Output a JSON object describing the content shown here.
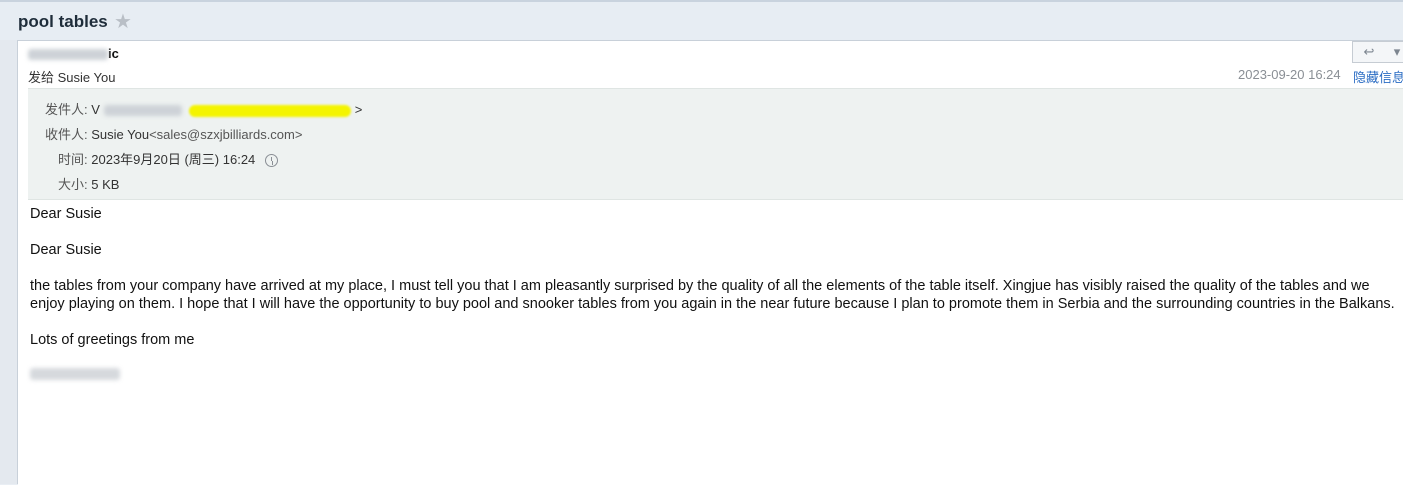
{
  "subject": "pool tables",
  "header": {
    "sender_name_visible": "ic",
    "to_line": "发给 Susie You",
    "date": "2023-09-20 16:24",
    "hide_details": "隐藏信息"
  },
  "icons": {
    "star": "star-icon",
    "reply": "reply-icon",
    "more": "chevron-down-icon",
    "history": "clock-icon"
  },
  "details": {
    "from_label": "发件人:",
    "from_value": "V",
    "from_suffix": ">",
    "to_label": "收件人:",
    "to_name": "Susie You",
    "to_email": "<sales@szxjbilliards.com>",
    "time_label": "时间:",
    "time_value": "2023年9月20日 (周三) 16:24",
    "size_label": "大小:",
    "size_value": "5 KB"
  },
  "body": {
    "greeting1": "Dear Susie",
    "greeting2": "Dear Susie",
    "paragraph": "the tables from your company have arrived at my place, I must tell you that I am pleasantly surprised by the quality of all the elements of the table itself. Xingjue has visibly raised the quality of the tables and we enjoy playing on them. I hope that I will have the opportunity to buy pool and snooker tables from you again in the near future because I plan to promote them in Serbia and the surrounding countries in the Balkans.",
    "closing": "Lots of greetings from me"
  },
  "colors": {
    "link": "#2a6cc3",
    "highlight": "#f4f400",
    "meta_bg": "#eef2f1"
  }
}
